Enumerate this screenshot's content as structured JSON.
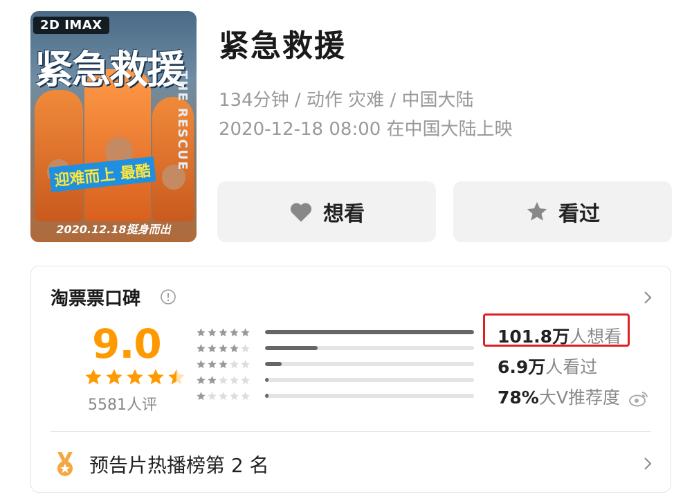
{
  "poster": {
    "badge": "2D IMAX",
    "title": "紧急救援",
    "english_title": "THE RESCUE",
    "tagline": "迎难而上 最酷",
    "release_line": "2020.12.18挺身而出"
  },
  "movie": {
    "title": "紧急救援",
    "meta_line": "134分钟 / 动作 灾难 / 中国大陆",
    "release_line": "2020-12-18 08:00 在中国大陆上映"
  },
  "actions": {
    "want_label": "想看",
    "want_icon": "heart-icon",
    "seen_label": "看过",
    "seen_icon": "star-icon"
  },
  "rating": {
    "section_title": "淘票票口碑",
    "info_icon": "info-circle-icon",
    "score": "9.0",
    "score_stars": 4.5,
    "rating_count": "5581人评",
    "distribution": [
      {
        "stars": 5,
        "fraction": 1.0
      },
      {
        "stars": 4,
        "fraction": 0.25
      },
      {
        "stars": 3,
        "fraction": 0.08
      },
      {
        "stars": 2,
        "fraction": 0.015
      },
      {
        "stars": 1,
        "fraction": 0.015
      }
    ],
    "stats": [
      {
        "value": "101.8万",
        "label": "人想看"
      },
      {
        "value": "6.9万",
        "label": "人看过"
      },
      {
        "value": "78%",
        "label": "大V推荐度"
      }
    ],
    "highlight_color": "#e02020"
  },
  "ranking": {
    "icon": "medal-icon",
    "text": "预告片热播榜第 2 名"
  },
  "colors": {
    "score": "#ff9900",
    "muted": "#999999",
    "button_bg": "#f2f2f2"
  }
}
